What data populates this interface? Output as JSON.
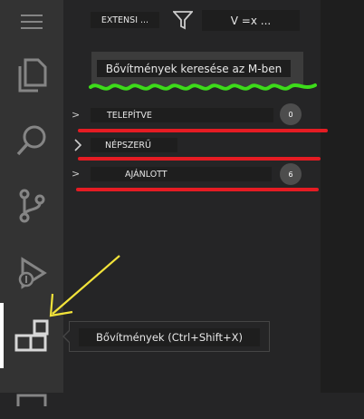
{
  "activity_bar": {
    "items": [
      {
        "icon": "menu-icon"
      },
      {
        "icon": "files-icon"
      },
      {
        "icon": "search-icon"
      },
      {
        "icon": "source-control-icon"
      },
      {
        "icon": "run-debug-icon"
      },
      {
        "icon": "extensions-icon",
        "active": true
      }
    ]
  },
  "header": {
    "view_title": "EXTENSI ...",
    "filter_icon": "filter-icon",
    "more_actions": "V =x ..."
  },
  "search": {
    "placeholder": "Bővítmények keresése az M-ben"
  },
  "sections": [
    {
      "chevron": ">",
      "label": "TELEPÍTVE",
      "badge": "0"
    },
    {
      "chevron": ">",
      "label": "NÉPSZERŰ",
      "badge": ""
    },
    {
      "chevron": ">",
      "label": "AJÁNLOTT",
      "badge": "6"
    }
  ],
  "tooltip": {
    "text": "Bővítmények (Ctrl+Shift+X)"
  },
  "colors": {
    "activity_bg": "#333333",
    "sidebar_bg": "#252526",
    "annotation_green": "#3ddc1a",
    "annotation_red": "#e51c23",
    "annotation_yellow": "#f2e33a"
  }
}
